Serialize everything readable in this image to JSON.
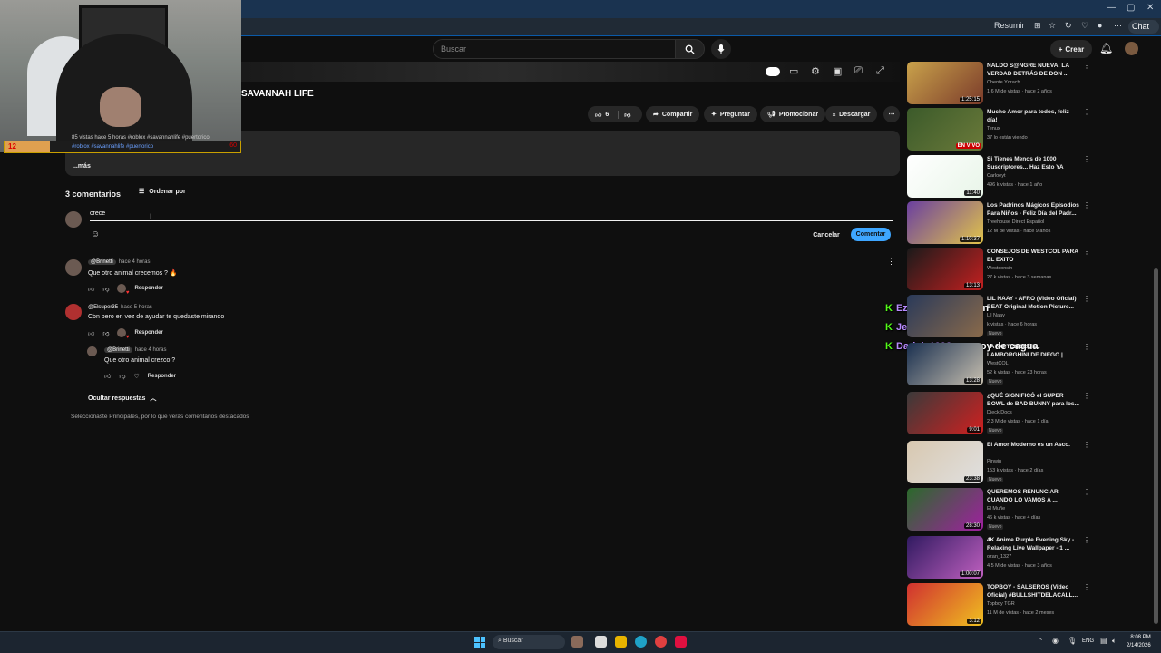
{
  "browser": {
    "summarize_label": "Resumir",
    "chat_label": "Chat",
    "window_controls": [
      "—",
      "▢",
      "✕"
    ]
  },
  "header": {
    "search_placeholder": "Buscar",
    "create_label": "Crear"
  },
  "video": {
    "title": "SAVANNAH LIFE",
    "likes": "6",
    "actions": {
      "share": "Compartir",
      "ask": "Preguntar",
      "promote": "Promocionar",
      "download": "Descargar"
    },
    "more_label": "...más"
  },
  "overlay": {
    "counter": "12",
    "stream_text": "85 vistas  hace 5 horas  #roblox #savannahlife #puertorico",
    "stream_sub": "#roblox #savannahlife #puertorico",
    "counter_right": "60"
  },
  "comments": {
    "count_label": "3 comentarios",
    "sort_label": "Ordenar por",
    "input_value": "crece",
    "cancel_label": "Cancelar",
    "submit_label": "Comentar",
    "items": [
      {
        "handle": "@Brinetti",
        "time": "hace 4 horas",
        "text": "Que otro animal crecemos ? 🔥",
        "reply_label": "Responder"
      },
      {
        "handle": "@Elsuper35",
        "time": "hace 5 horas",
        "text": "Cbn pero en vez de ayudar te quedaste mirando",
        "reply_label": "Responder"
      },
      {
        "handle": "@Brinetti",
        "time": "hace 4 horas",
        "text": "Que otro animal crezco ?",
        "reply_label": "Responder"
      }
    ],
    "hide_replies_label": "Ocultar respuestas",
    "selected_note": "Seleccionaste Principales, por lo que verás comentarios destacados"
  },
  "chat_overlay": [
    {
      "user": "Ezequiel139",
      "message": "quien"
    },
    {
      "user": "Jean1234",
      "message": "kelvin"
    },
    {
      "user": "Dariel_1998",
      "message": "yo soy de cagua"
    }
  ],
  "recommendations": [
    {
      "title": "NALDO S@NGRE NUEVA: LA VERDAD DETRÁS DE DON ...",
      "channel": "Chente Ydrach",
      "meta": "1.6 M de vistas · hace 2 años",
      "duration": "1:25:15",
      "badge": ""
    },
    {
      "title": "Mucho Amor para todos, feliz día!",
      "channel": "Tenux",
      "meta": "37 lo están viendo",
      "duration": "EN VIVO",
      "badge": ""
    },
    {
      "title": "Si Tienes Menos de 1000 Suscriptores... Haz Esto YA",
      "channel": "Carloeyt",
      "meta": "496 k vistas · hace 1 año",
      "duration": "11:40",
      "badge": ""
    },
    {
      "title": "Los Padrinos Mágicos Episodios Para Niños - Feliz Día del Padr...",
      "channel": "Treehouse Direct Español",
      "meta": "12 M de vistas · hace 9 años",
      "duration": "1:10:37",
      "badge": ""
    },
    {
      "title": "CONSEJOS DE WESTCOL PARA EL EXITO",
      "channel": "Westconsin",
      "meta": "27 k vistas · hace 3 semanas",
      "duration": "13:13",
      "badge": ""
    },
    {
      "title": "LIL NAAY - AFRO (Video Oficial) BEAT Original Motion Picture...",
      "channel": "Lil Naay",
      "meta": "k vistas · hace 6 horas",
      "duration": "",
      "badge": "Nuevo"
    },
    {
      "title": "YA NO TENDRÉ EL LAMBORGHINI DE DIEGO | WESTCOL",
      "channel": "WestCOL",
      "meta": "52 k vistas · hace 23 horas",
      "duration": "13:28",
      "badge": "Nuevo"
    },
    {
      "title": "¿QUÉ SIGNIFICÓ el SUPER BOWL de BAD BUNNY para los...",
      "channel": "Dieck Docs",
      "meta": "2.3 M de vistas · hace 1 día",
      "duration": "9:01",
      "badge": "Nuevo"
    },
    {
      "title": "El Amor Moderno es un Asco.",
      "channel": "Pinwin",
      "meta": "153 k vistas · hace 2 días",
      "duration": "23:38",
      "badge": "Nuevo"
    },
    {
      "title": "QUEREMOS RENUNCIAR CUANDO LO VAMOS A ...",
      "channel": "El Muñe",
      "meta": "46 k vistas · hace 4 días",
      "duration": "28:30",
      "badge": "Nuevo"
    },
    {
      "title": "4K Anime Purple Evening Sky - Relaxing Live Wallpaper - 1 ...",
      "channel": "ozan_1327",
      "meta": "4.5 M de vistas · hace 3 años",
      "duration": "1:00:07",
      "badge": ""
    },
    {
      "title": "TOPBOY - SALSEROS (Video Oficial) #BULLSHITDELACALL...",
      "channel": "Topboy TGR",
      "meta": "11 M de vistas · hace 2 meses",
      "duration": "3:12",
      "badge": ""
    }
  ],
  "taskbar": {
    "search_label": "Buscar",
    "lang": "ENG",
    "time": "8:08 PM",
    "date": "2/14/2026"
  },
  "colors": {
    "accent": "#3ea6ff",
    "background": "#0f0f0f",
    "live": "#cc0000"
  }
}
